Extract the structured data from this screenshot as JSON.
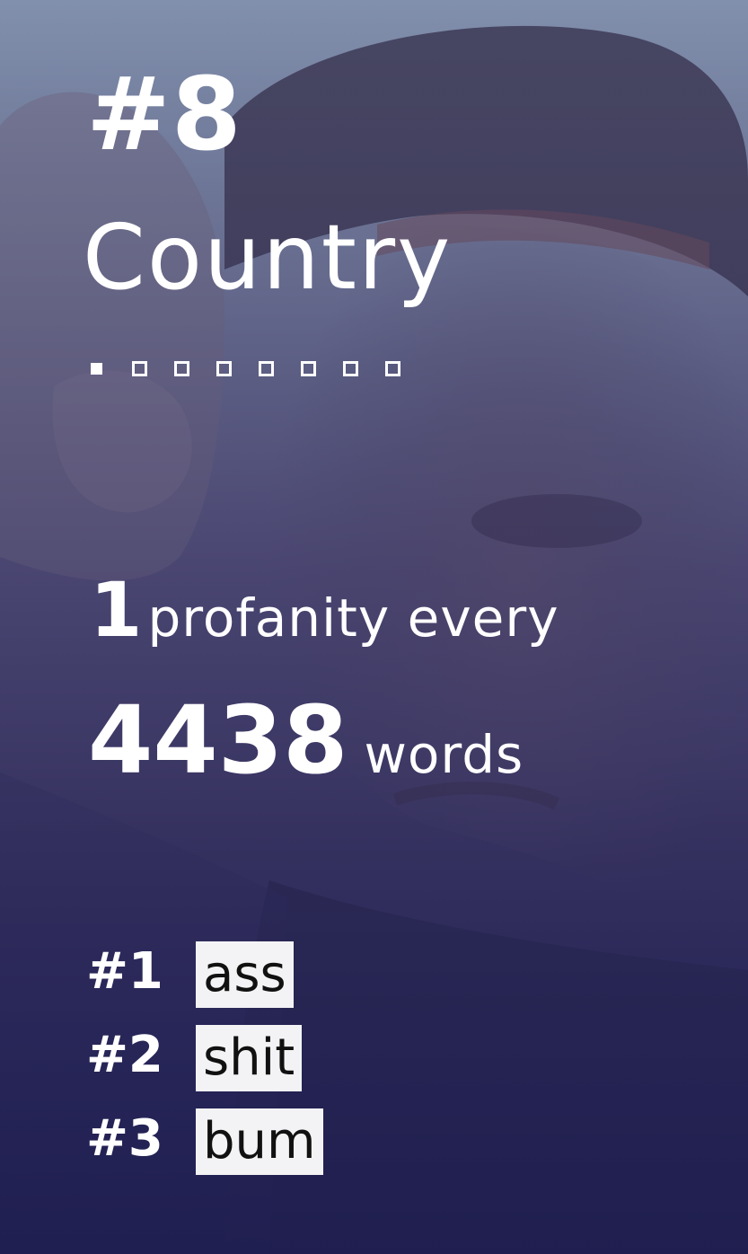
{
  "rank": "#8",
  "genre": "Country",
  "rank_squares": {
    "total": 8,
    "filled": 1
  },
  "stat": {
    "count": "1",
    "count_text": "profanity every",
    "words": "4438",
    "words_text": "words"
  },
  "top_words": [
    {
      "rank": "#1",
      "word": "ass"
    },
    {
      "rank": "#2",
      "word": "shit"
    },
    {
      "rank": "#3",
      "word": "bum"
    }
  ],
  "colors": {
    "text": "#ffffff",
    "word_chip_bg": "#f3f3f5",
    "word_chip_text": "#111111",
    "background_top": "#8190ad",
    "background_bottom": "#201f52"
  }
}
